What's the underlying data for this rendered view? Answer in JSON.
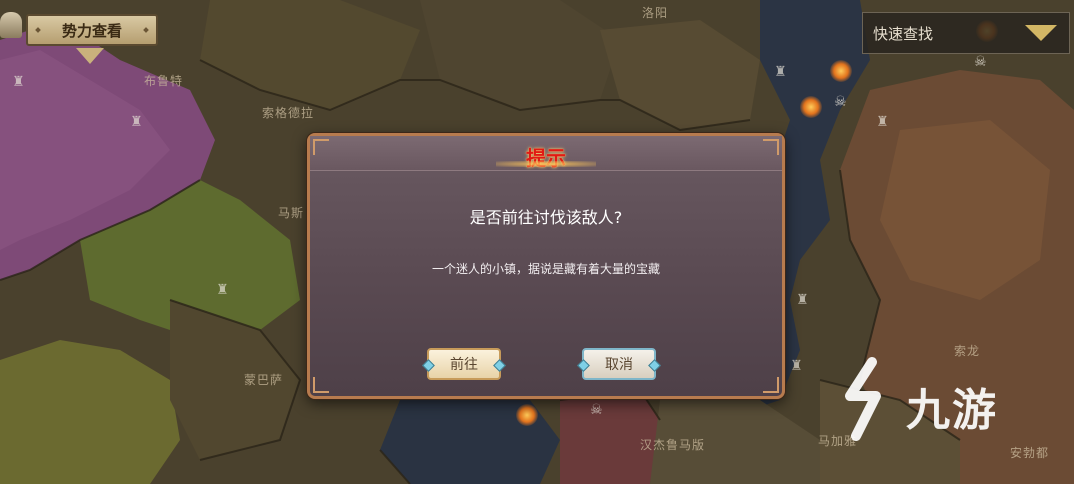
{
  "faction_button": {
    "label": "势力查看"
  },
  "quick_search": {
    "label": "快速查找"
  },
  "map": {
    "regions": [
      {
        "id": "luoyang",
        "name": "洛阳"
      },
      {
        "id": "xiangte",
        "name": "布鲁特"
      },
      {
        "id": "suogedela",
        "name": "索格德拉"
      },
      {
        "id": "ma",
        "name": "马斯"
      },
      {
        "id": "mengbasa",
        "name": "蒙巴萨"
      },
      {
        "id": "hanjieluomaban",
        "name": "汉杰鲁马版"
      },
      {
        "id": "majiayi",
        "name": "马加雅"
      },
      {
        "id": "suolong",
        "name": "索龙"
      },
      {
        "id": "anbodu",
        "name": "安勃都"
      }
    ]
  },
  "dialog": {
    "title": "提示",
    "question": "是否前往讨伐该敌人?",
    "description": "一个迷人的小镇，据说是藏有着大量的宝藏",
    "confirm_label": "前往",
    "cancel_label": "取消"
  },
  "watermark": {
    "text": "九游"
  },
  "colors": {
    "title_red": "#e11a14",
    "dialog_bg": "#5e4e56",
    "dialog_border": "#b77b4e",
    "accent_gold": "#d3b765"
  },
  "icons": [
    "helmet-icon",
    "castle-icon",
    "torch-icon",
    "skull-icon",
    "dropdown-arrow-icon",
    "jiuyou-logo-icon"
  ]
}
